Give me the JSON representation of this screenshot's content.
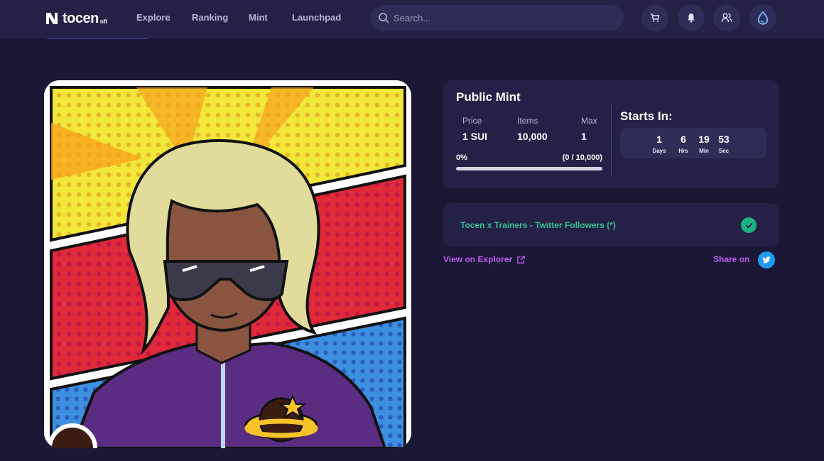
{
  "nav": {
    "logo_text": "tocen",
    "logo_sub": "nft",
    "links": [
      "Explore",
      "Ranking",
      "Mint",
      "Launchpad"
    ],
    "search_placeholder": "Search...",
    "icons": [
      "cart-icon",
      "bell-icon",
      "users-icon",
      "sui-drop-icon"
    ]
  },
  "mint": {
    "title": "Public Mint",
    "price_label": "Price",
    "price_value": "1 SUI",
    "items_label": "Items",
    "items_value": "10,000",
    "max_label": "Max",
    "max_value": "1",
    "progress_pct": "0%",
    "progress_count": "(0 / 10,000)",
    "progress_fraction": 0,
    "starts_title": "Starts In:",
    "countdown": [
      {
        "value": "1",
        "unit": "Days"
      },
      {
        "value": "6",
        "unit": "Hrs"
      },
      {
        "value": "19",
        "unit": "Min"
      },
      {
        "value": "53",
        "unit": "Sec"
      }
    ]
  },
  "requirement": {
    "label": "Tocen x Trainers - Twitter Followers (*)",
    "status_icon": "check-icon"
  },
  "links": {
    "view_explorer": "View on Explorer",
    "share_on": "Share on"
  },
  "colors": {
    "background": "#1b1836",
    "card": "#242046",
    "accent_purple": "#c15bf3",
    "accent_green": "#2fc48d",
    "twitter_blue": "#1d9bf0"
  }
}
